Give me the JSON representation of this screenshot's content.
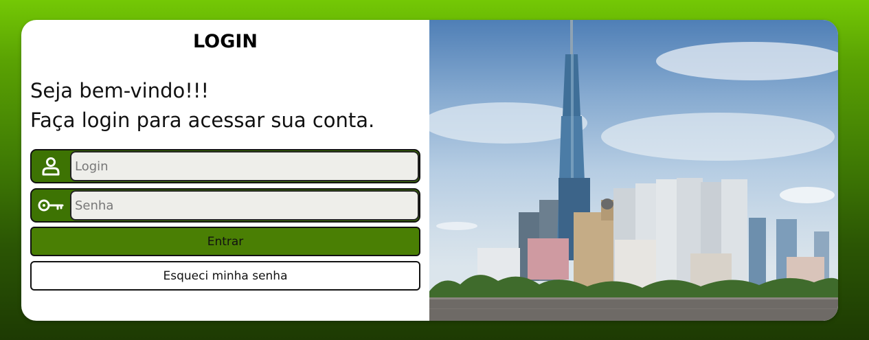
{
  "login_panel": {
    "title": "LOGIN",
    "welcome_line1": "Seja bem-vindo!!!",
    "welcome_line2": "Faça login para acessar sua conta.",
    "login_field": {
      "placeholder": "Login",
      "value": ""
    },
    "password_field": {
      "placeholder": "Senha",
      "value": ""
    },
    "submit_label": "Entrar",
    "forgot_label": "Esqueci minha senha"
  },
  "icons": {
    "login_field_icon": "user-icon",
    "password_field_icon": "key-icon"
  },
  "colors": {
    "accent_green": "#4a7f04",
    "field_green": "#3d7303",
    "background_top": "#74c805",
    "background_bottom": "#1d3a03"
  }
}
